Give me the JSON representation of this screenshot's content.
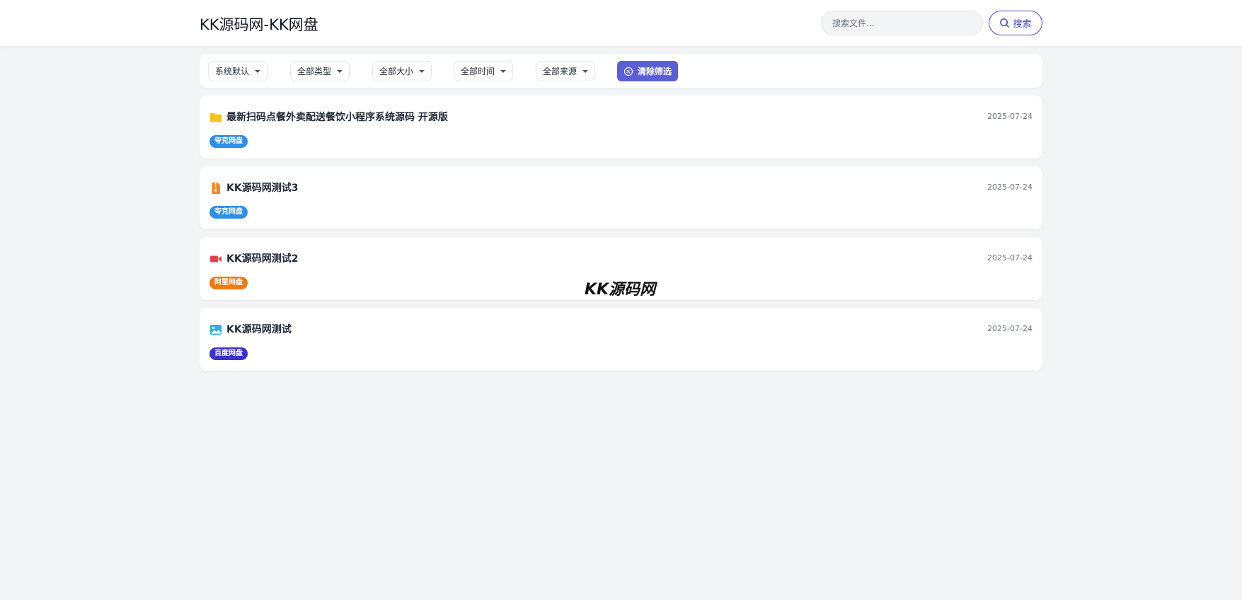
{
  "header": {
    "site_title": "KK源码网-KK网盘",
    "search_placeholder": "搜索文件...",
    "search_button_label": "搜索"
  },
  "filters": {
    "sort": "系统默认",
    "type": "全部类型",
    "size": "全部大小",
    "time": "全部时间",
    "source": "全部来源",
    "clear_label": "清除筛选"
  },
  "files": [
    {
      "title": "最新扫码点餐外卖配送餐饮小程序系统源码 开源版",
      "date": "2025-07-24",
      "tag": "夸克网盘",
      "tag_color": "#2f8fe8",
      "icon": "folder-icon"
    },
    {
      "title": "KK源码网测试3",
      "date": "2025-07-24",
      "tag": "夸克网盘",
      "tag_color": "#2f8fe8",
      "icon": "archive-file-icon"
    },
    {
      "title": "KK源码网测试2",
      "date": "2025-07-24",
      "tag": "阿里网盘",
      "tag_color": "#f07a12",
      "icon": "video-camera-icon"
    },
    {
      "title": "KK源码网测试",
      "date": "2025-07-24",
      "tag": "百度网盘",
      "tag_color": "#3b33c9",
      "icon": "image-file-icon"
    }
  ],
  "watermark": "KK源码网",
  "colors": {
    "accent": "#5b5fd6",
    "background": "#f3f4f6"
  }
}
